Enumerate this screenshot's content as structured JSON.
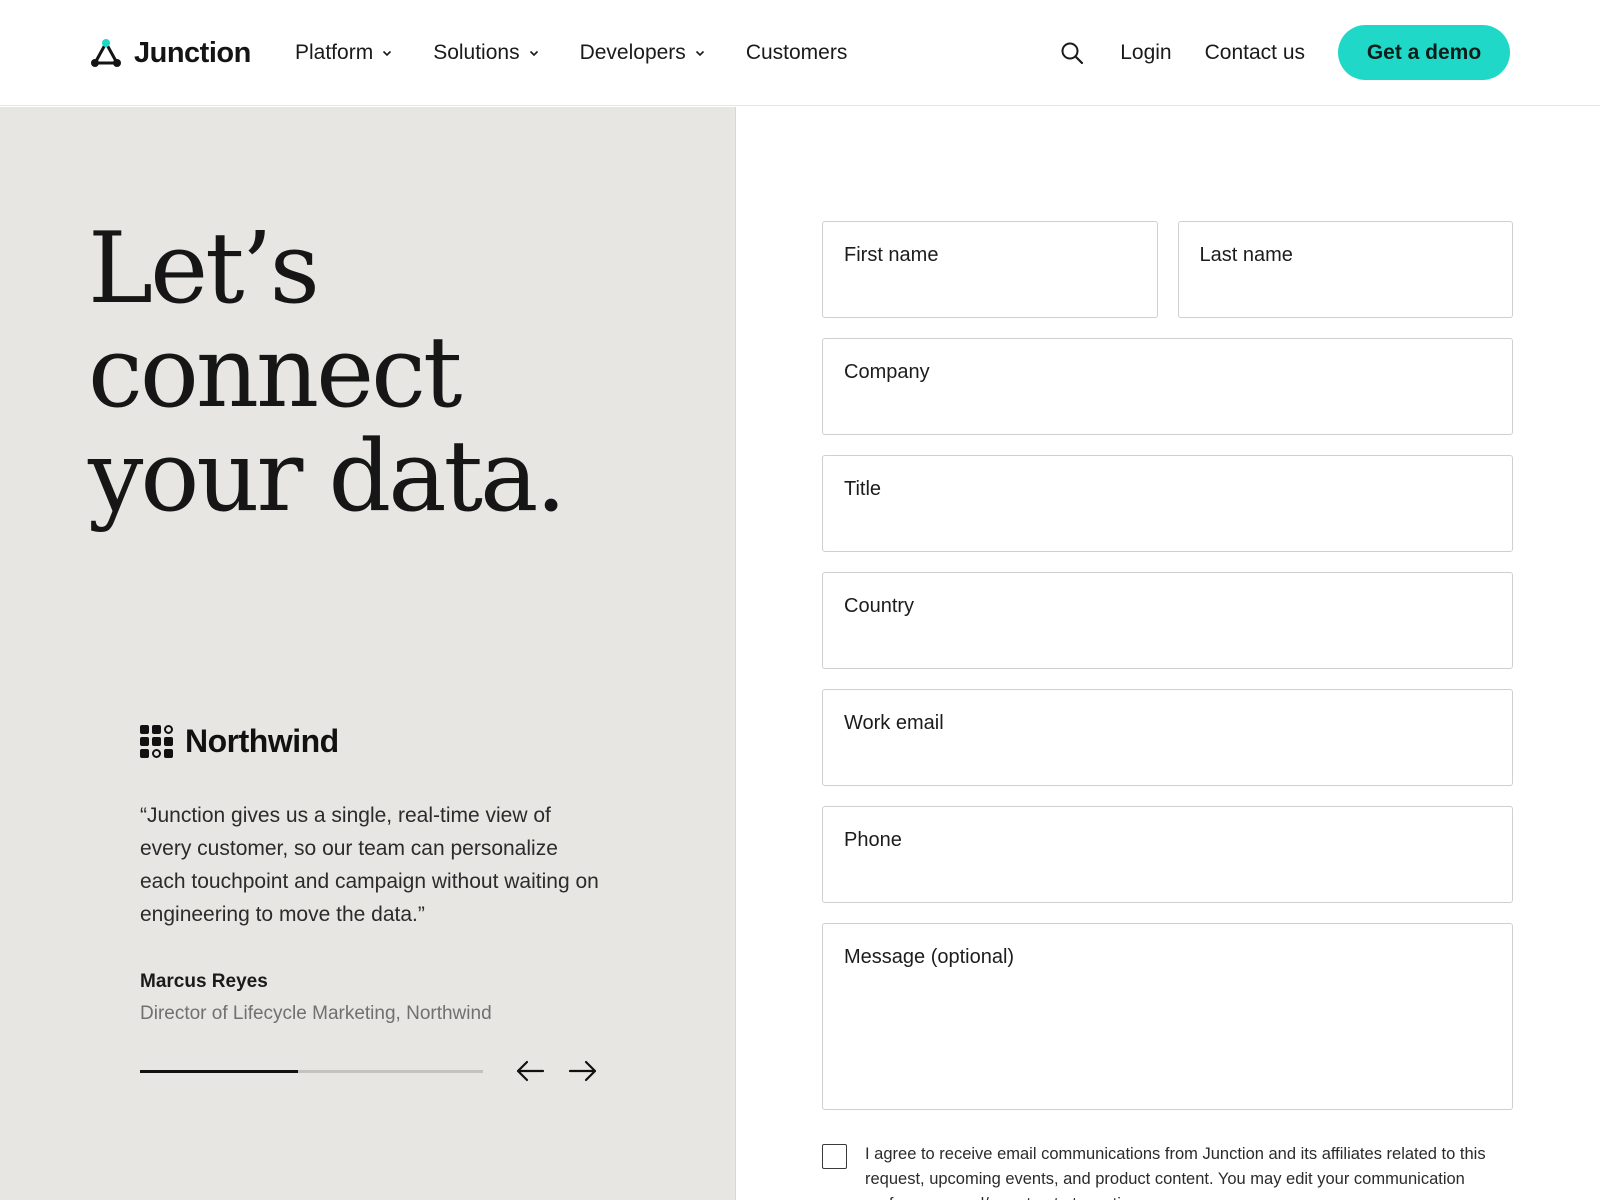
{
  "header": {
    "logo_text": "Junction",
    "nav": [
      {
        "label": "Platform",
        "has_dropdown": true
      },
      {
        "label": "Solutions",
        "has_dropdown": true
      },
      {
        "label": "Developers",
        "has_dropdown": true
      },
      {
        "label": "Customers",
        "has_dropdown": false
      }
    ],
    "login_label": "Login",
    "contact_label": "Contact us",
    "demo_label": "Get a demo"
  },
  "hero": {
    "lines": [
      "Let’s",
      "connect",
      "your data."
    ]
  },
  "testimonial": {
    "brand": "Northwind",
    "quote": "“Junction gives us a single, real-time view of every customer, so our team can personalize each touchpoint and campaign without waiting on engineering to move the data.”",
    "author": "Marcus Reyes",
    "role": "Director of Lifecycle Marketing, Northwind",
    "progress_fraction": 0.46
  },
  "form": {
    "first_name": {
      "label": "First name",
      "value": ""
    },
    "last_name": {
      "label": "Last name",
      "value": ""
    },
    "company": {
      "label": "Company",
      "value": ""
    },
    "title": {
      "label": "Title",
      "value": ""
    },
    "country": {
      "label": "Country",
      "value": ""
    },
    "work_email": {
      "label": "Work email",
      "value": ""
    },
    "phone": {
      "label": "Phone",
      "value": ""
    },
    "message": {
      "label": "Message (optional)",
      "value": ""
    },
    "consent": {
      "checked": false,
      "text": "I agree to receive email communications from Junction and its affiliates related to this request, upcoming events, and product content. You may edit your communication preferences and/or opt out at any time."
    }
  },
  "colors": {
    "accent": "#1fd8c8",
    "left_panel_bg": "#e7e6e3",
    "text_dark": "#161616",
    "text_muted": "#707070"
  },
  "icons": {
    "logo": "triangle-nodes-icon",
    "search": "search-icon",
    "chevron": "chevron-down-icon",
    "prev": "arrow-left-icon",
    "next": "arrow-right-icon",
    "brand": "grid-dots-icon"
  }
}
